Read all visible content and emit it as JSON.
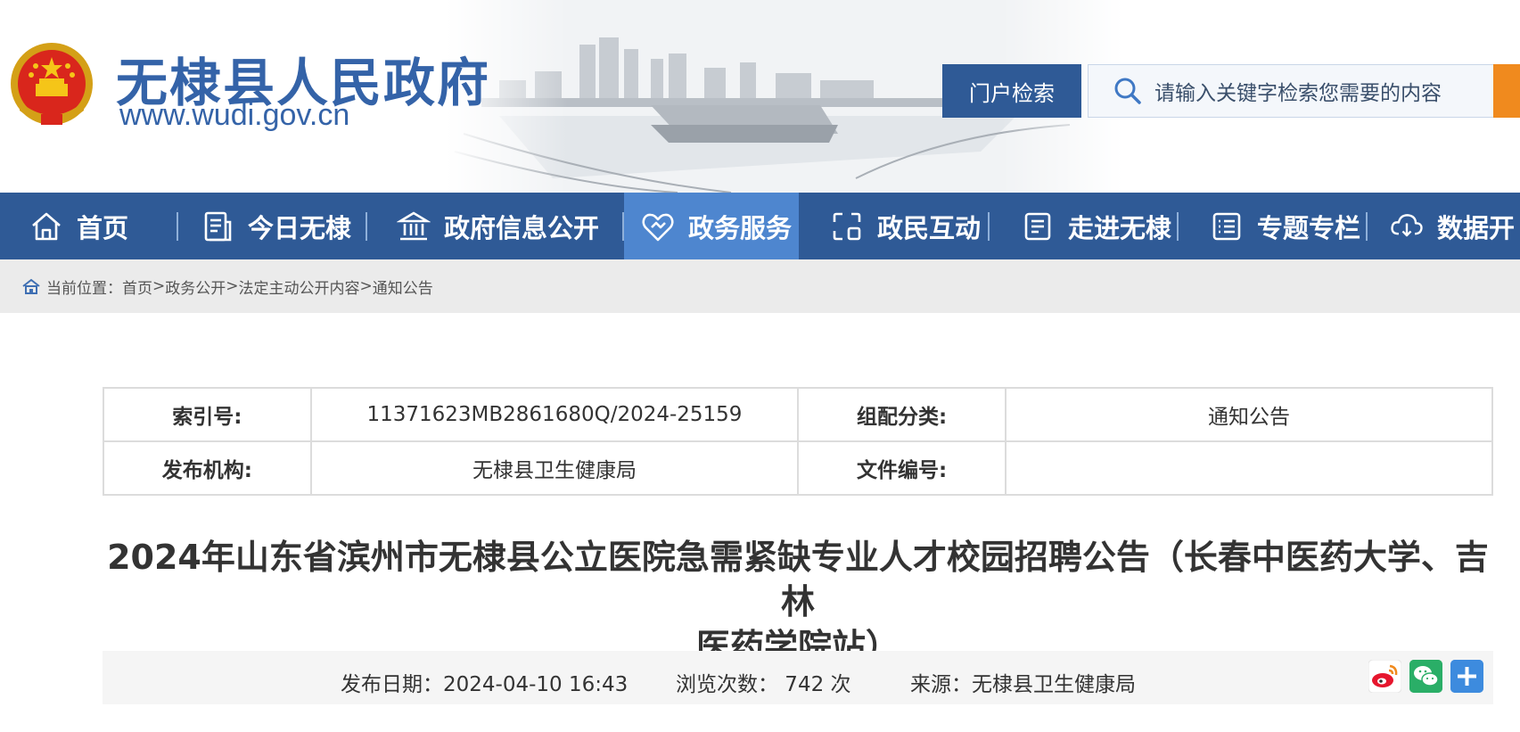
{
  "header": {
    "site_title": "无棣县人民政府",
    "site_url": "www.wudi.gov.cn",
    "search_tab_label": "门户检索",
    "search_placeholder": "请输入关键字检索您需要的内容"
  },
  "nav": {
    "items": [
      {
        "label": "首页",
        "icon": "home-icon"
      },
      {
        "label": "今日无棣",
        "icon": "news-icon"
      },
      {
        "label": "政府信息公开",
        "icon": "government-building-icon"
      },
      {
        "label": "政务服务",
        "icon": "handshake-heart-icon",
        "active": true
      },
      {
        "label": "政民互动",
        "icon": "interaction-icon"
      },
      {
        "label": "走进无棣",
        "icon": "document-list-icon"
      },
      {
        "label": "专题专栏",
        "icon": "checklist-icon"
      },
      {
        "label": "数据开",
        "icon": "cloud-download-icon"
      }
    ]
  },
  "breadcrumb": {
    "prefix": "当前位置：",
    "items": [
      "首页",
      "政务公开",
      "法定主动公开内容",
      "通知公告"
    ],
    "separator": ">"
  },
  "info": {
    "index_key": "索引号:",
    "index_value": "11371623MB2861680Q/2024-25159",
    "category_key": "组配分类:",
    "category_value": "通知公告",
    "publisher_key": "发布机构:",
    "publisher_value": "无棣县卫生健康局",
    "doc_no_key": "文件编号:",
    "doc_no_value": ""
  },
  "article": {
    "title_line1": "2024年山东省滨州市无棣县公立医院急需紧缺专业人才校园招聘公告（长春中医药大学、吉林",
    "title_line2": "医药学院站）",
    "publish_date": "发布日期：2024-04-10 16:43",
    "views": "浏览次数： 742 次",
    "source": "来源：无棣县卫生健康局"
  },
  "colors": {
    "brand_blue": "#2f5a96",
    "nav_active": "#4e86cf",
    "title_blue": "#3463a8",
    "search_orange": "#f08a1e",
    "weibo_red": "#e6162d",
    "wechat_green": "#2aae67",
    "share_blue": "#3d8bde"
  },
  "share": {
    "icons": [
      "weibo-icon",
      "wechat-icon",
      "more-share-icon"
    ]
  }
}
